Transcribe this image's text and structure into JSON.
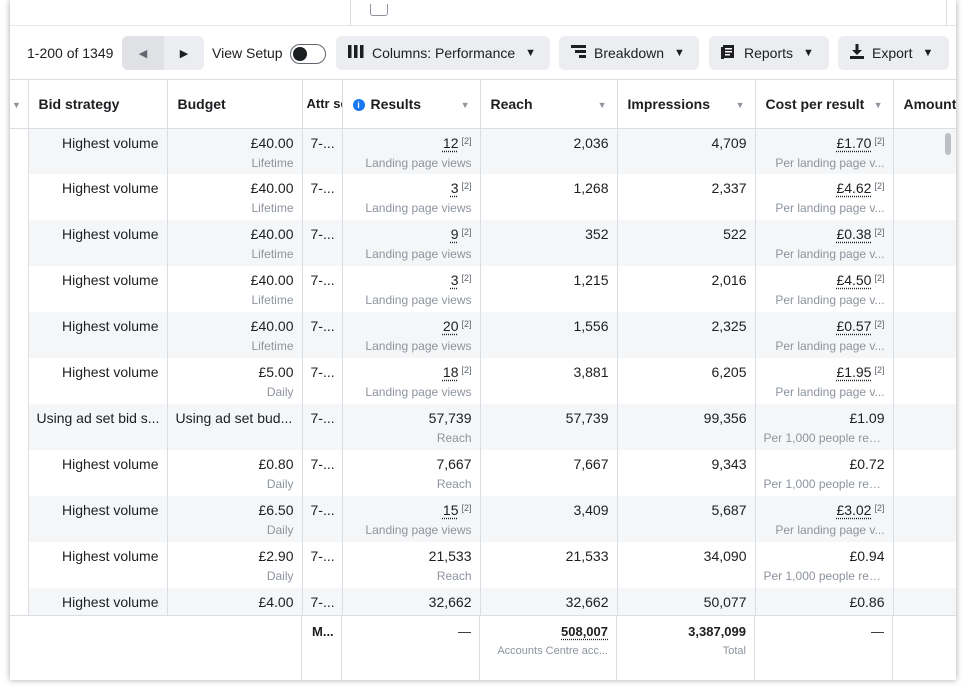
{
  "toolbar": {
    "pager": "1-200 of 1349",
    "view_setup": "View Setup",
    "columns": "Columns: Performance",
    "breakdown": "Breakdown",
    "reports": "Reports",
    "export": "Export"
  },
  "headers": {
    "bid_strategy": "Bid strategy",
    "budget": "Budget",
    "attr": "Attr sett",
    "results": "Results",
    "reach": "Reach",
    "impressions": "Impressions",
    "cost_per_result": "Cost per result",
    "amount": "Amount"
  },
  "rows": [
    {
      "bid": "Highest volume",
      "budget": "£40.00",
      "budget_sub": "Lifetime",
      "attr": "7-...",
      "results": "12",
      "results_sub": "Landing page views",
      "reach": "2,036",
      "impr": "4,709",
      "cpr": "£1.70",
      "cpr_sub": "Per landing page v..."
    },
    {
      "bid": "Highest volume",
      "budget": "£40.00",
      "budget_sub": "Lifetime",
      "attr": "7-...",
      "results": "3",
      "results_sub": "Landing page views",
      "reach": "1,268",
      "impr": "2,337",
      "cpr": "£4.62",
      "cpr_sub": "Per landing page v..."
    },
    {
      "bid": "Highest volume",
      "budget": "£40.00",
      "budget_sub": "Lifetime",
      "attr": "7-...",
      "results": "9",
      "results_sub": "Landing page views",
      "reach": "352",
      "impr": "522",
      "cpr": "£0.38",
      "cpr_sub": "Per landing page v..."
    },
    {
      "bid": "Highest volume",
      "budget": "£40.00",
      "budget_sub": "Lifetime",
      "attr": "7-...",
      "results": "3",
      "results_sub": "Landing page views",
      "reach": "1,215",
      "impr": "2,016",
      "cpr": "£4.50",
      "cpr_sub": "Per landing page v..."
    },
    {
      "bid": "Highest volume",
      "budget": "£40.00",
      "budget_sub": "Lifetime",
      "attr": "7-...",
      "results": "20",
      "results_sub": "Landing page views",
      "reach": "1,556",
      "impr": "2,325",
      "cpr": "£0.57",
      "cpr_sub": "Per landing page v..."
    },
    {
      "bid": "Highest volume",
      "budget": "£5.00",
      "budget_sub": "Daily",
      "attr": "7-...",
      "results": "18",
      "results_sub": "Landing page views",
      "reach": "3,881",
      "impr": "6,205",
      "cpr": "£1.95",
      "cpr_sub": "Per landing page v..."
    },
    {
      "bid": "Using ad set bid s...",
      "budget": "Using ad set bud...",
      "budget_sub": "",
      "attr": "7-...",
      "results": "57,739",
      "results_sub": "Reach",
      "reach": "57,739",
      "impr": "99,356",
      "cpr": "£1.09",
      "cpr_sub": "Per 1,000 people rea..."
    },
    {
      "bid": "Highest volume",
      "budget": "£0.80",
      "budget_sub": "Daily",
      "attr": "7-...",
      "results": "7,667",
      "results_sub": "Reach",
      "reach": "7,667",
      "impr": "9,343",
      "cpr": "£0.72",
      "cpr_sub": "Per 1,000 people rea..."
    },
    {
      "bid": "Highest volume",
      "budget": "£6.50",
      "budget_sub": "Daily",
      "attr": "7-...",
      "results": "15",
      "results_sub": "Landing page views",
      "reach": "3,409",
      "impr": "5,687",
      "cpr": "£3.02",
      "cpr_sub": "Per landing page v..."
    },
    {
      "bid": "Highest volume",
      "budget": "£2.90",
      "budget_sub": "Daily",
      "attr": "7-...",
      "results": "21,533",
      "results_sub": "Reach",
      "reach": "21,533",
      "impr": "34,090",
      "cpr": "£0.94",
      "cpr_sub": "Per 1,000 people rea..."
    },
    {
      "bid": "Highest volume",
      "budget": "£4.00",
      "budget_sub": "",
      "attr": "7-...",
      "results": "32,662",
      "results_sub": "",
      "reach": "32,662",
      "impr": "50,077",
      "cpr": "£0.86",
      "cpr_sub": ""
    }
  ],
  "footer": {
    "attr": "M...",
    "results": "—",
    "reach": "508,007",
    "reach_sub": "Accounts Centre acc...",
    "impr": "3,387,099",
    "impr_sub": "Total",
    "cpr": "—"
  },
  "superscript": "[2]"
}
